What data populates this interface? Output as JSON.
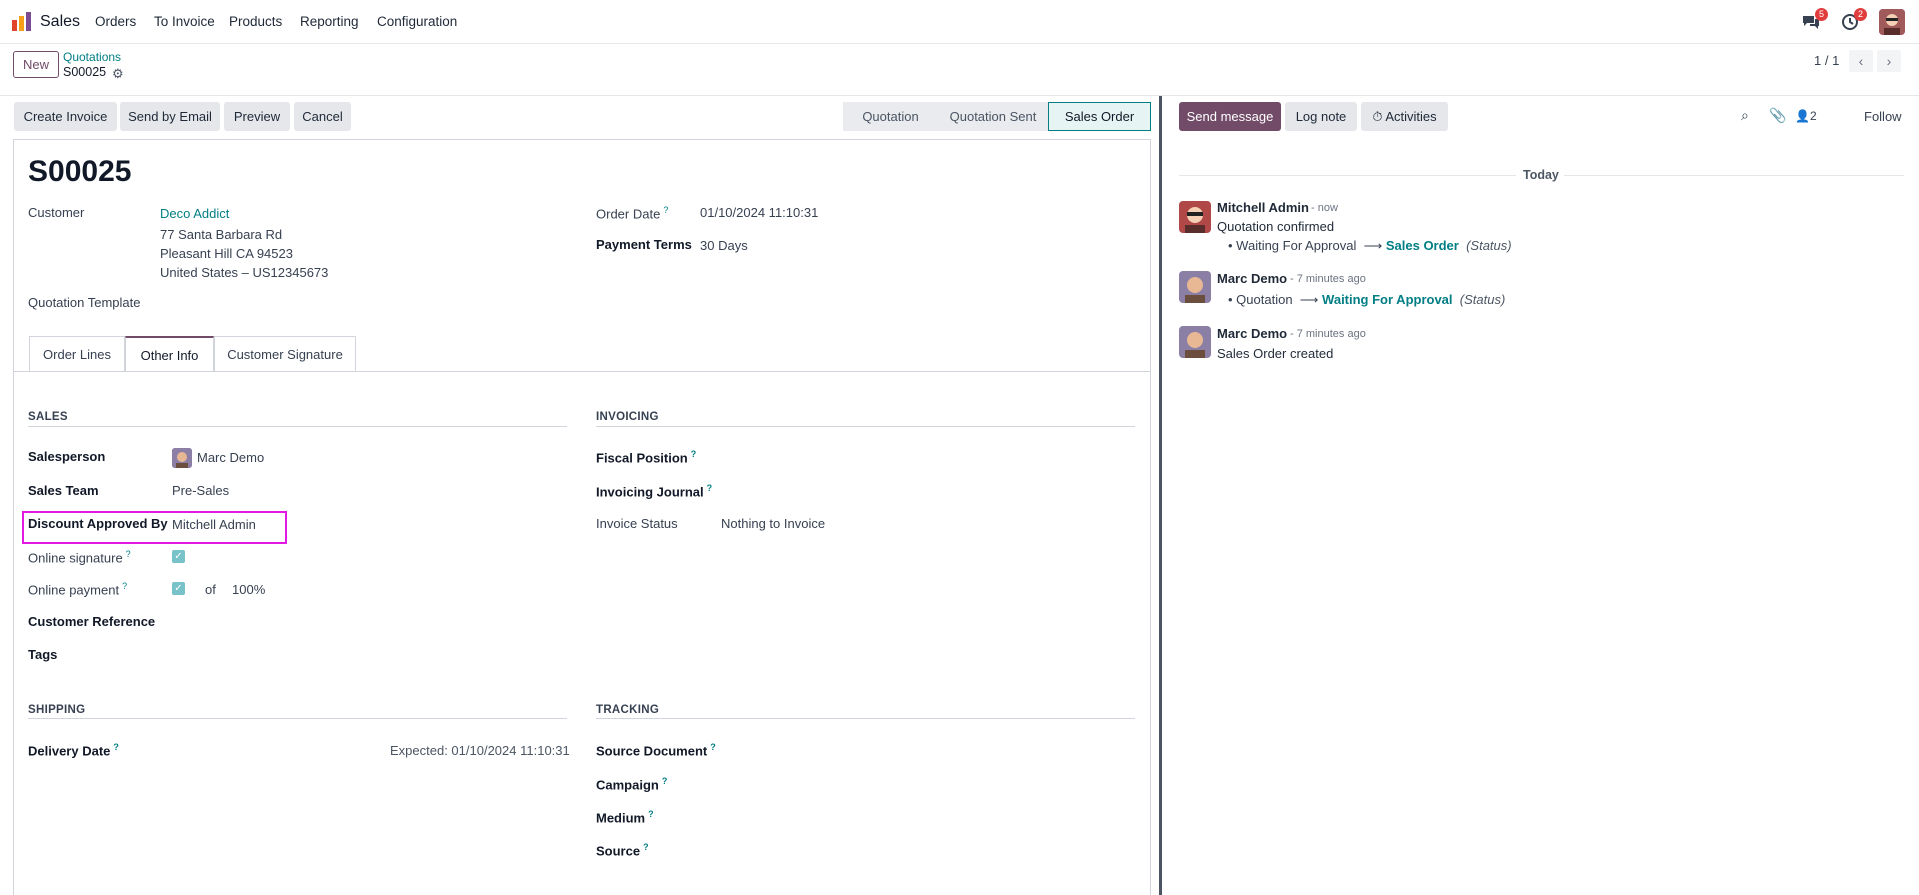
{
  "navbar": {
    "app_name": "Sales",
    "menu": [
      "Orders",
      "To Invoice",
      "Products",
      "Reporting",
      "Configuration"
    ],
    "messages_badge": "5",
    "activities_badge": "2"
  },
  "control_panel": {
    "new_label": "New",
    "breadcrumb_parent": "Quotations",
    "breadcrumb_current": "S00025",
    "pager": "1 / 1"
  },
  "actions": {
    "create_invoice": "Create Invoice",
    "send_by_email": "Send by Email",
    "preview": "Preview",
    "cancel": "Cancel"
  },
  "statusbar": {
    "stages": [
      "Quotation",
      "Quotation Sent",
      "Sales Order"
    ],
    "active": "Sales Order"
  },
  "record": {
    "name": "S00025",
    "customer_label": "Customer",
    "customer_name": "Deco Addict",
    "address_line1": "77 Santa Barbara Rd",
    "address_line2": "Pleasant Hill CA 94523",
    "address_line3": "United States – US12345673",
    "quotation_template_label": "Quotation Template",
    "order_date_label": "Order Date",
    "order_date": "01/10/2024 11:10:31",
    "payment_terms_label": "Payment Terms",
    "payment_terms": "30 Days"
  },
  "tabs": [
    "Order Lines",
    "Other Info",
    "Customer Signature"
  ],
  "other_info": {
    "sales_section": "SALES",
    "salesperson_label": "Salesperson",
    "salesperson": "Marc Demo",
    "sales_team_label": "Sales Team",
    "sales_team": "Pre-Sales",
    "discount_approved_label": "Discount Approved By",
    "discount_approved": "Mitchell Admin",
    "online_signature_label": "Online signature",
    "online_payment_label": "Online payment",
    "online_payment_of": "of",
    "online_payment_pct": "100%",
    "customer_reference_label": "Customer Reference",
    "tags_label": "Tags",
    "invoicing_section": "INVOICING",
    "fiscal_position_label": "Fiscal Position",
    "invoicing_journal_label": "Invoicing Journal",
    "invoice_status_label": "Invoice Status",
    "invoice_status": "Nothing to Invoice",
    "shipping_section": "SHIPPING",
    "delivery_date_label": "Delivery Date",
    "delivery_expected": "Expected: 01/10/2024 11:10:31",
    "tracking_section": "TRACKING",
    "source_document_label": "Source Document",
    "campaign_label": "Campaign",
    "medium_label": "Medium",
    "source_label": "Source"
  },
  "chatter": {
    "send_message": "Send message",
    "log_note": "Log note",
    "activities": "Activities",
    "followers_count": "2",
    "follow": "Follow",
    "date_separator": "Today",
    "messages": [
      {
        "author": "Mitchell Admin",
        "time": "- now",
        "body": "Quotation confirmed",
        "old": "Waiting For Approval",
        "new": "Sales Order",
        "field": "(Status)"
      },
      {
        "author": "Marc Demo",
        "time": "- 7 minutes ago",
        "body": "",
        "old": "Quotation",
        "new": "Waiting For Approval",
        "field": "(Status)"
      },
      {
        "author": "Marc Demo",
        "time": "- 7 minutes ago",
        "body": "Sales Order created"
      }
    ]
  },
  "colors": {
    "brand": "#714b67",
    "link": "#017e84",
    "highlight_box": "#e219e2"
  }
}
